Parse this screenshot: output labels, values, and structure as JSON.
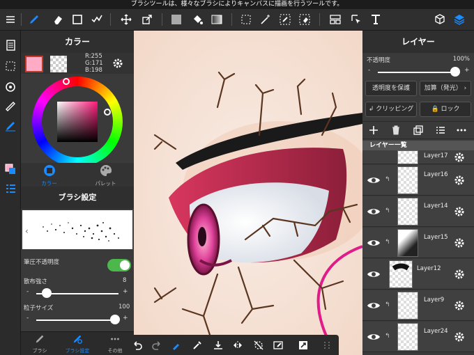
{
  "notice": "ブラシツールは、様々なブラシによりキャンバスに描画を行うツールです。",
  "left_panel": {
    "color_title": "カラー",
    "rgb": {
      "r": "R:255",
      "g": "G:171",
      "b": "B:198"
    },
    "tabs": [
      {
        "label": "カラー"
      },
      {
        "label": "パレット"
      }
    ],
    "brush_title": "ブラシ設定",
    "opacity_label": "筆圧不透明度",
    "scatter_label": "散布強さ",
    "scatter_value": "8",
    "particle_label": "粒子サイズ",
    "particle_value": "100",
    "minus": "-",
    "plus": "+",
    "bottom_tabs": [
      {
        "label": "ブラシ"
      },
      {
        "label": "ブラシ設定"
      },
      {
        "label": "その他"
      }
    ]
  },
  "right_panel": {
    "title": "レイヤー",
    "opacity_label": "不透明度",
    "opacity_value": "100%",
    "minus": "-",
    "plus": "+",
    "protect_label": "透明度を保護",
    "blend_label": "加算（発光）",
    "clipping_label": "クリッピング",
    "lock_label": "ロック",
    "list_title": "レイヤー一覧",
    "layers": [
      {
        "name": "Layer17"
      },
      {
        "name": "Layer16"
      },
      {
        "name": "Layer14"
      },
      {
        "name": "Layer15"
      },
      {
        "name": "Layer12"
      },
      {
        "name": "Layer9"
      },
      {
        "name": "Layer24"
      }
    ]
  },
  "colors": {
    "accent": "#1a8cff",
    "fg_color": "#ffabc6",
    "toggle": "#4cb84c"
  }
}
